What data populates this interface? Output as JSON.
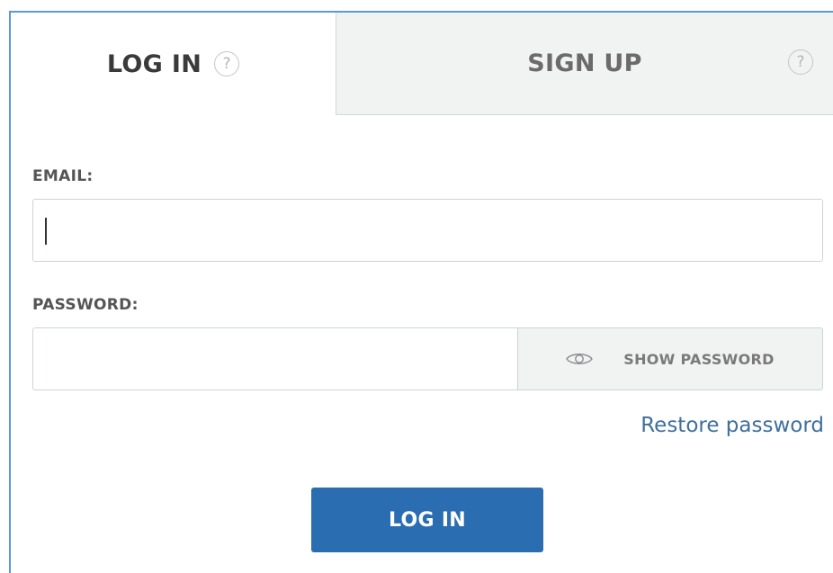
{
  "tabs": {
    "login": {
      "label": "LOG IN",
      "help_icon": "?"
    },
    "signup": {
      "label": "SIGN UP",
      "help_icon": "?"
    }
  },
  "form": {
    "email": {
      "label": "EMAIL:",
      "value": "",
      "placeholder": ""
    },
    "password": {
      "label": "PASSWORD:",
      "value": "",
      "placeholder": "",
      "show_label": "SHOW PASSWORD"
    },
    "restore_label": "Restore password",
    "submit_label": "LOG IN"
  },
  "colors": {
    "accent": "#2a6db0",
    "link": "#3f6f9c",
    "panel_border": "#5b9bd5",
    "inactive_tab_bg": "#f1f2f2"
  },
  "icons": {
    "help": "question-circle-icon",
    "show_password": "eye-icon"
  }
}
